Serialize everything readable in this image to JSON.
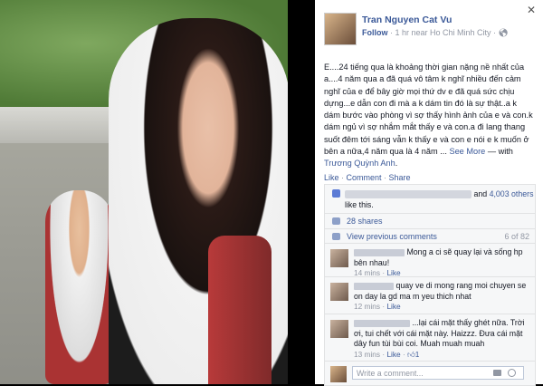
{
  "photo": {
    "alt": "selfie photo"
  },
  "panel": {
    "close_icon": "close-icon",
    "author": "Tran Nguyen Cat Vu",
    "follow": "Follow",
    "meta": " · 1 hr near Ho Chi Minh City · ",
    "post_text": "E....24 tiếng qua là khoảng thời gian nặng nề nhất của a....4 năm qua a đã quá vô tâm k nghĩ nhiều đến cảm nghĩ của e để bây giờ mọi thứ dv e đã quá sức chịu dựng...e dẫn con đi mà a k dám tin đó là sự thật..a k dám bước vào phòng vì sợ thấy hình ảnh của e và con.k dám ngủ vì sợ nhắm mắt thấy e và con.a đi lang thang suốt đêm tới sáng vẫn k thấy e và con e nói e k muốn ở bên a nữa,4 năm qua là 4 năm ...",
    "see_more": " See More",
    "with_prefix": " — with ",
    "with_name": "Trương Quỳnh Anh",
    "actions": {
      "like": "Like",
      "comment": "Comment",
      "share": "Share",
      "sep": " · "
    },
    "likes": {
      "and": "and ",
      "count_link": "4,003 others",
      "suffix": " like this."
    },
    "shares": "28 shares",
    "view_previous": "View previous comments",
    "comment_count": "6 of 82",
    "comments": [
      {
        "text": "Mong a ci sẽ quay lại và sống hp bên nhau!",
        "time": "14 mins",
        "like": "Like"
      },
      {
        "text": "quay ve di mong rang moi chuyen se on day la gd ma m yeu thich nhat",
        "time": "12 mins",
        "like": "Like"
      },
      {
        "text": "...lại cái mặt thấy ghét nữa. Trời ơi, tui chết với cái mặt này. Haizzz. Đưa cái mặt dây fun tùi bùi coi. Muah muah muah",
        "time": "13 mins",
        "like": "Like",
        "likes": "1"
      },
      {
        "text": "",
        "time": "",
        "like": ""
      }
    ],
    "write_placeholder": "Write a comment..."
  }
}
